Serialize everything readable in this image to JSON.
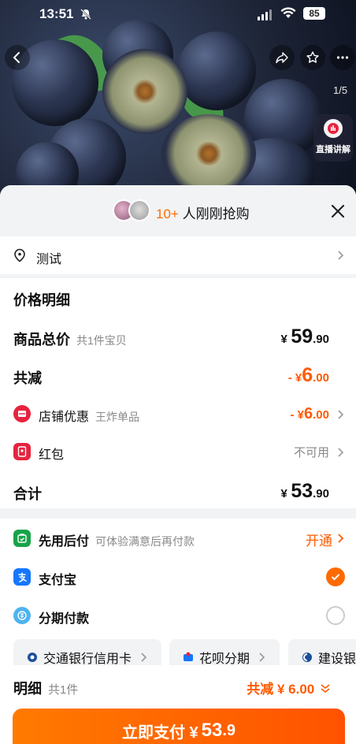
{
  "status_bar": {
    "time": "13:51",
    "battery": "85"
  },
  "gallery": {
    "counter": "1/5",
    "live_label": "直播讲解"
  },
  "sheet": {
    "header": {
      "count": "10+",
      "text": "人刚刚抢购"
    },
    "address": {
      "text": "测试"
    },
    "price_detail": {
      "title": "价格明细",
      "goods_total": {
        "label": "商品总价",
        "sub": "共1件宝贝",
        "cur": "¥",
        "int": "59",
        "dec": ".90"
      },
      "reduction": {
        "label": "共减",
        "prefix": "- ¥",
        "int": "6",
        "dec": ".00"
      },
      "shop_discount": {
        "label": "店铺优惠",
        "sub": "王炸单品",
        "prefix": "- ¥",
        "int": "6",
        "dec": ".00"
      },
      "red_packet": {
        "label": "红包",
        "value": "不可用"
      },
      "total": {
        "label": "合计",
        "cur": "¥",
        "int": "53",
        "dec": ".90"
      }
    },
    "payment": {
      "pay_later": {
        "label": "先用后付",
        "sub": "可体验满意后再付款",
        "action": "开通"
      },
      "alipay": {
        "label": "支付宝"
      },
      "installment": {
        "label": "分期付款"
      },
      "options": [
        "交通银行信用卡",
        "花呗分期",
        "建设银"
      ]
    }
  },
  "footer": {
    "detail_label": "明细",
    "detail_sub": "共1件",
    "reduce_text": "共减 ¥ 6.00",
    "pay_label": "立即支付 ¥",
    "pay_int": "53",
    "pay_dec": ".9"
  },
  "colors": {
    "accent": "#ff5a00",
    "alipay": "#1677ff",
    "red": "#e6233e"
  }
}
